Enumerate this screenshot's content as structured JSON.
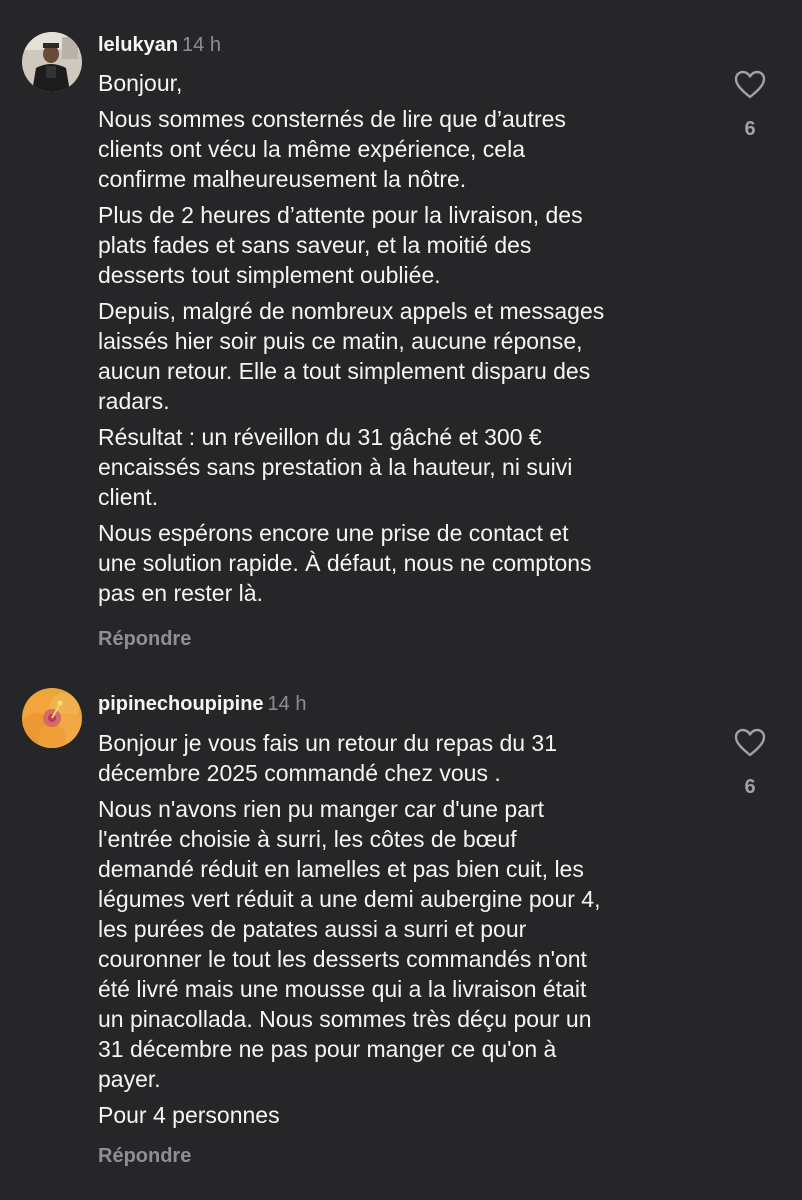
{
  "comments": [
    {
      "username": "lelukyan",
      "time": "14 h",
      "paragraphs": [
        "Bonjour,",
        "Nous sommes consternés de lire que d’autres\nclients ont vécu la même expérience, cela\nconfirme malheureusement la nôtre.",
        "Plus de 2 heures d’attente pour la livraison, des\nplats fades et sans saveur, et la moitié des\ndesserts tout simplement oubliée.",
        "Depuis, malgré de nombreux appels et messages\nlaissés hier soir puis ce matin, aucune réponse,\naucun retour. Elle a tout simplement disparu des\nradars.",
        "Résultat : un réveillon du 31 gâché et 300 €\nencaissés sans prestation à la hauteur, ni suivi\nclient.",
        "Nous espérons encore une prise de contact et\nune solution rapide. À défaut, nous ne comptons\npas en rester là."
      ],
      "reply_label": "Répondre",
      "likes": "6",
      "avatar_icon": "person-photo-avatar"
    },
    {
      "username": "pipinechoupipine",
      "time": "14 h",
      "paragraphs": [
        "Bonjour je vous fais un retour du repas du 31\ndécembre 2025 commandé chez vous .",
        "Nous n'avons rien pu manger  car d'une part\nl'entrée choisie à  surri,  les côtes de bœuf\ndemandé réduit en lamelles et pas bien cuit, les\nlégumes vert réduit a une demi aubergine pour 4,\nles purées de patates aussi  a surri et pour\ncouronner le tout les desserts commandés n'ont\nété livré mais une mousse qui a la livraison était\nun pinacollada.  Nous sommes très déçu pour un\n31 décembre ne pas pour manger ce qu'on à\npayer.",
        "Pour 4 personnes"
      ],
      "reply_label": "Répondre",
      "likes": "6",
      "avatar_icon": "hibiscus-flower-avatar"
    }
  ],
  "colors": {
    "background": "#262628",
    "text": "#f5f5f5",
    "muted": "#8e8e93"
  }
}
